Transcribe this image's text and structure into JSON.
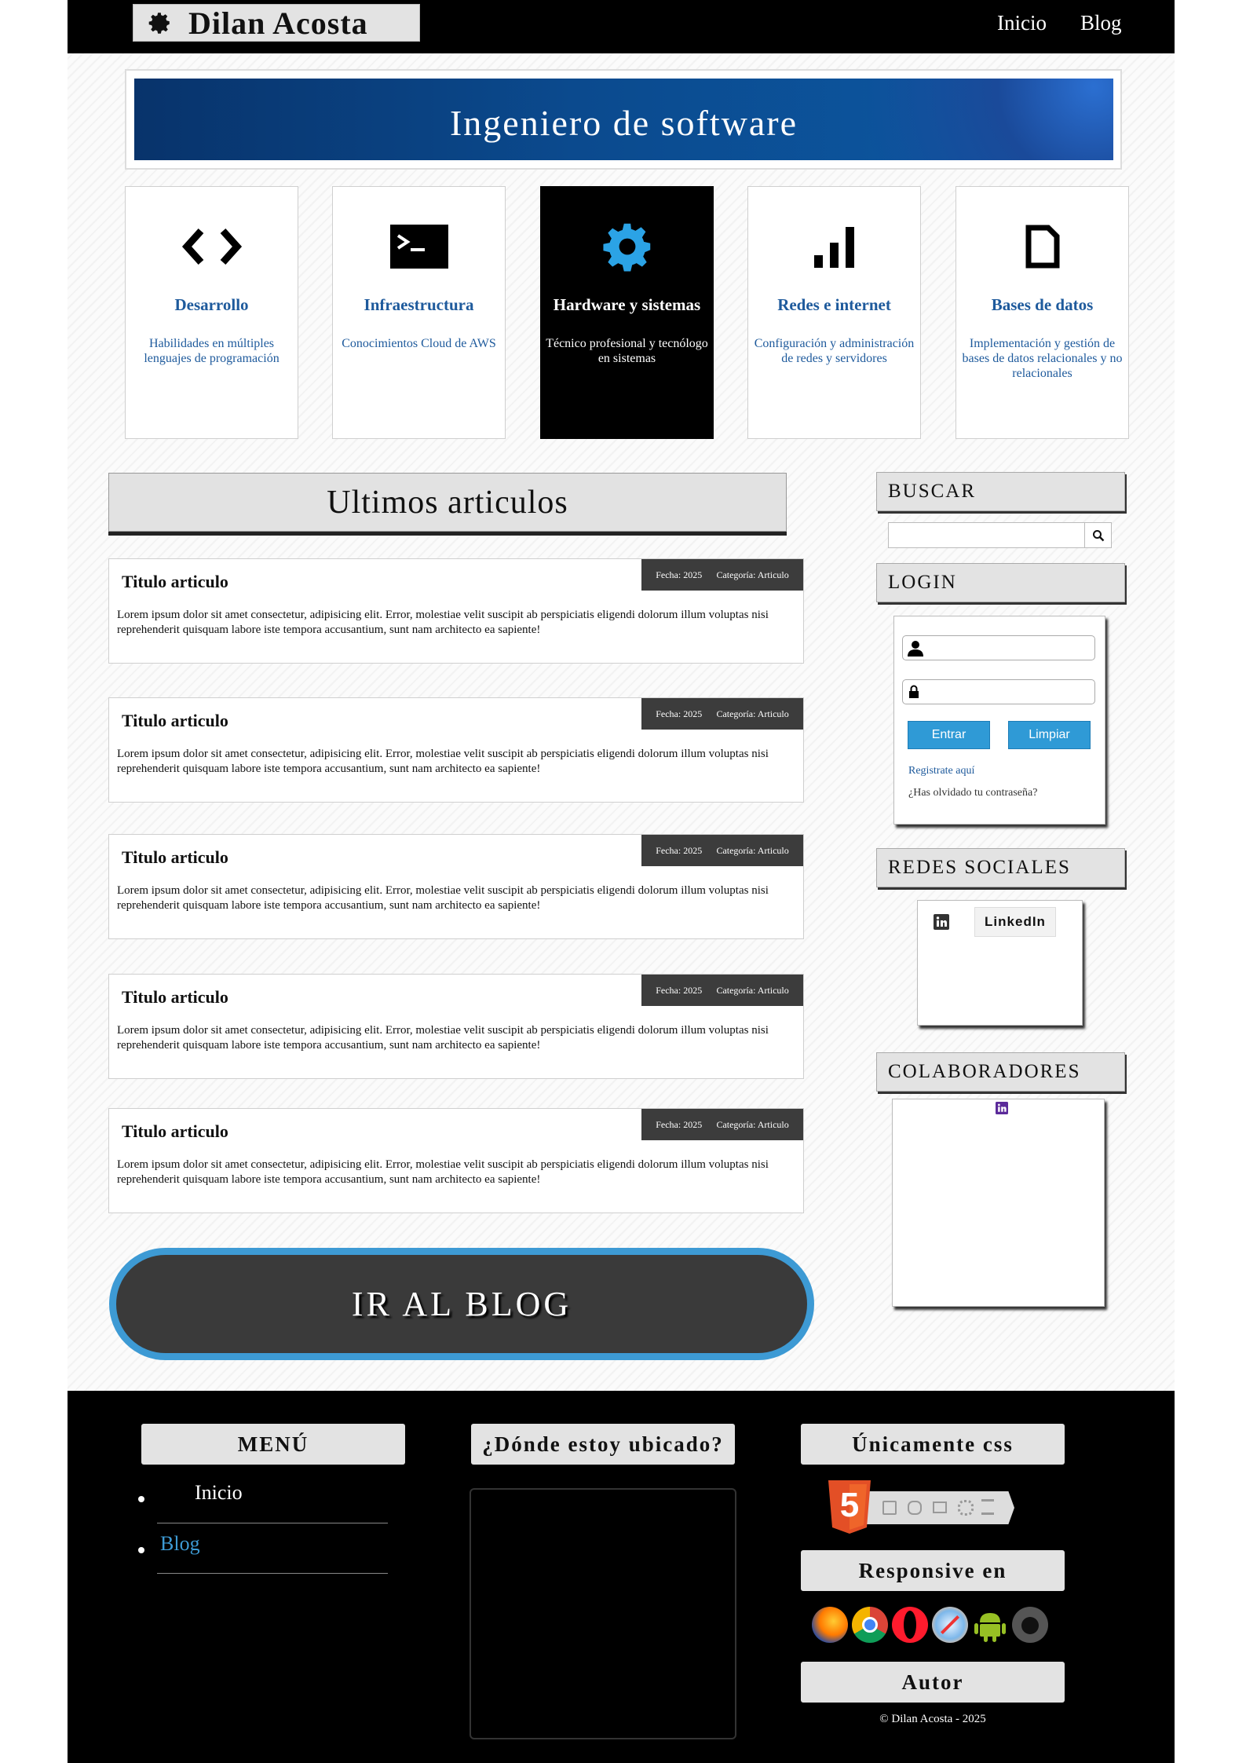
{
  "header": {
    "brand": "Dilan Acosta",
    "nav": [
      "Inicio",
      "Blog"
    ]
  },
  "banner": {
    "title": "Ingeniero de software"
  },
  "cards": [
    {
      "icon": "code-icon",
      "title": "Desarrollo",
      "desc": "Habilidades en múltiples lenguajes de programación"
    },
    {
      "icon": "terminal-icon",
      "title": "Infraestructura",
      "desc": "Conocimientos Cloud de AWS"
    },
    {
      "icon": "gear-icon",
      "title": "Hardware y sistemas",
      "desc": "Técnico profesional y tecnólogo en sistemas"
    },
    {
      "icon": "signal-bars-icon",
      "title": "Redes e internet",
      "desc": "Configuración y administración de redes y servidores"
    },
    {
      "icon": "document-icon",
      "title": "Bases de datos",
      "desc": "Implementación y gestión de bases de datos relacionales y no relacionales"
    }
  ],
  "articles_section": {
    "title": "Ultimos articulos"
  },
  "articles": [
    {
      "title": "Titulo articulo",
      "fecha": "Fecha: 2025",
      "categoria": "Categoría: Articulo",
      "body": "Lorem ipsum dolor sit amet consectetur, adipisicing elit. Error, molestiae velit suscipit ab perspiciatis eligendi dolorum illum voluptas nisi reprehenderit quisquam labore iste tempora accusantium, sunt nam architecto ea sapiente!"
    },
    {
      "title": "Titulo articulo",
      "fecha": "Fecha: 2025",
      "categoria": "Categoría: Articulo",
      "body": "Lorem ipsum dolor sit amet consectetur, adipisicing elit. Error, molestiae velit suscipit ab perspiciatis eligendi dolorum illum voluptas nisi reprehenderit quisquam labore iste tempora accusantium, sunt nam architecto ea sapiente!"
    },
    {
      "title": "Titulo articulo",
      "fecha": "Fecha: 2025",
      "categoria": "Categoría: Articulo",
      "body": "Lorem ipsum dolor sit amet consectetur, adipisicing elit. Error, molestiae velit suscipit ab perspiciatis eligendi dolorum illum voluptas nisi reprehenderit quisquam labore iste tempora accusantium, sunt nam architecto ea sapiente!"
    },
    {
      "title": "Titulo articulo",
      "fecha": "Fecha: 2025",
      "categoria": "Categoría: Articulo",
      "body": "Lorem ipsum dolor sit amet consectetur, adipisicing elit. Error, molestiae velit suscipit ab perspiciatis eligendi dolorum illum voluptas nisi reprehenderit quisquam labore iste tempora accusantium, sunt nam architecto ea sapiente!"
    },
    {
      "title": "Titulo articulo",
      "fecha": "Fecha: 2025",
      "categoria": "Categoría: Articulo",
      "body": "Lorem ipsum dolor sit amet consectetur, adipisicing elit. Error, molestiae velit suscipit ab perspiciatis eligendi dolorum illum voluptas nisi reprehenderit quisquam labore iste tempora accusantium, sunt nam architecto ea sapiente!"
    }
  ],
  "blog_button": {
    "label": "IR AL BLOG"
  },
  "sidebar": {
    "search": {
      "heading": "BUSCAR",
      "value": "",
      "placeholder": ""
    },
    "login": {
      "heading": "LOGIN",
      "submit": "Entrar",
      "clear": "Limpiar",
      "register": "Registrate aquí",
      "forgot": "¿Has olvidado tu contraseña?"
    },
    "social": {
      "heading": "REDES SOCIALES",
      "linkedin": "LinkedIn"
    },
    "collaborators": {
      "heading": "COLABORADORES"
    }
  },
  "footer": {
    "menu_heading": "MENÚ",
    "menu": [
      {
        "label": "Inicio"
      },
      {
        "label": "Blog"
      }
    ],
    "location_heading": "¿Dónde estoy ubicado?",
    "css_heading": "Únicamente css",
    "html5_badge": "5",
    "responsive_heading": "Responsive en",
    "browsers": [
      "firefox-icon",
      "chrome-icon",
      "opera-icon",
      "safari-icon",
      "android-icon",
      "apple-icon"
    ],
    "author_heading": "Autor",
    "copyright": "© Dilan Acosta - 2025"
  },
  "colors": {
    "accent": "#3d9ad4",
    "card_title": "#1e5a9c",
    "link_active": "#3d9ad4",
    "meta_bg": "#3c3c3c"
  }
}
